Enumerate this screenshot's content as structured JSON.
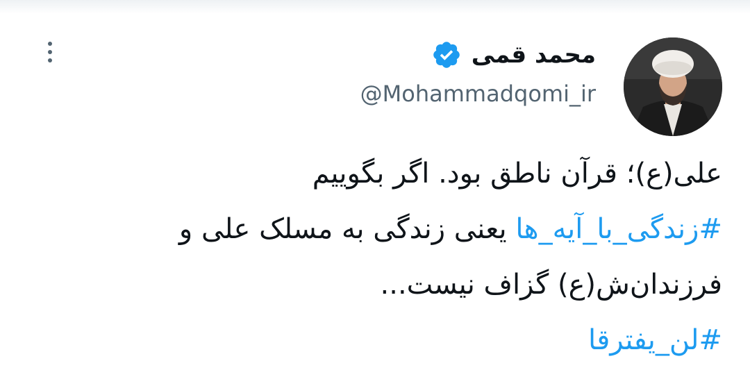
{
  "tweet": {
    "display_name": "محمد قمی",
    "handle": "@Mohammadqomi_ir",
    "verified": true,
    "accent_color": "#1d9bf0",
    "text_color": "#0f1419",
    "secondary_color": "#536471",
    "body": {
      "line1": "علی(ع)؛ قرآن ناطق بود. اگر بگوییم",
      "hashtag1": "#زندگی_با_آیه_ها",
      "line2_rest": " یعنی زندگی به مسلک علی و",
      "line3": "فرزندان‌ش(ع) گزاف نیست...",
      "hashtag2": "#لن_یفترقا"
    },
    "icons": {
      "more": "more-vertical-icon",
      "verified": "verified-badge-icon"
    }
  }
}
